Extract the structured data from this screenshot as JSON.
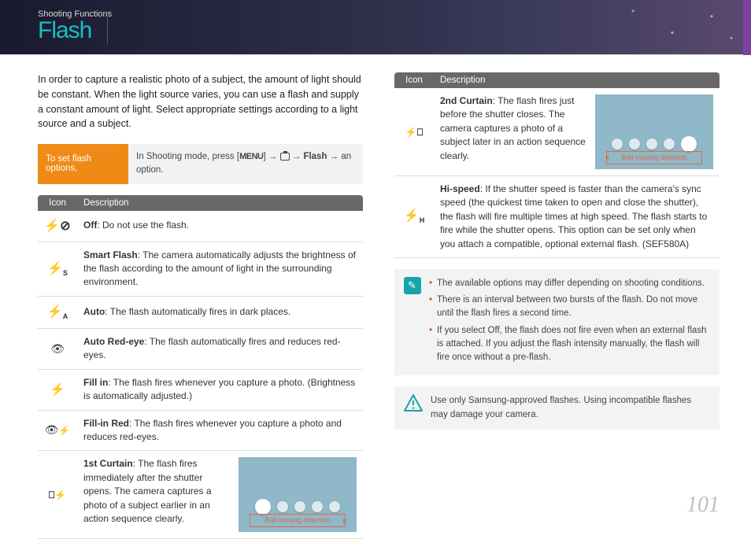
{
  "header": {
    "breadcrumb": "Shooting Functions",
    "title": "Flash"
  },
  "intro": "In order to capture a realistic photo of a subject, the amount of light should be constant. When the light source varies, you can use a flash and supply a constant amount of light. Select appropriate settings according to a light source and a subject.",
  "howto": {
    "label": "To set flash options,",
    "line_pre": "In Shooting mode, press [",
    "menu": "MENU",
    "mid1": "] → ",
    "mid2": " → ",
    "flash_label": "Flash",
    "tail": " → an option."
  },
  "table": {
    "head_icon": "Icon",
    "head_desc": "Description"
  },
  "rows_left": [
    {
      "title": "Off",
      "body": ": Do not use the flash."
    },
    {
      "title": "Smart Flash",
      "body": ": The camera automatically adjusts the brightness of the flash according to the amount of light in the surrounding environment."
    },
    {
      "title": "Auto",
      "body": ": The flash automatically fires in dark places."
    },
    {
      "title": "Auto Red-eye",
      "body": ": The flash automatically fires and reduces red-eyes."
    },
    {
      "title": "Fill in",
      "body": ": The flash fires whenever you capture a photo. (Brightness is automatically adjusted.)"
    },
    {
      "title": "Fill-in Red",
      "body": ": The flash fires whenever you capture a photo and reduces red-eyes."
    },
    {
      "title": "1st Curtain",
      "body": ": The flash fires immediately after the shutter opens. The camera captures a photo of a subject earlier in an action sequence clearly."
    }
  ],
  "rows_right": [
    {
      "title": "2nd Curtain",
      "body": ": The flash fires just before the shutter closes. The camera captures a photo of a subject later in an action sequence clearly."
    },
    {
      "title": "Hi-speed",
      "body": ": If the shutter speed is faster than the camera's sync speed (the quickest time taken to open and close the shutter), the flash will fire multiple times at high speed. The flash starts to fire while the shutter opens. This option can be set only when you attach a compatible, optional external flash. (SEF580A)"
    }
  ],
  "ball_dir_label": "Ball moving direction",
  "notes": [
    "The available options may differ depending on shooting conditions.",
    "There is an interval between two bursts of the flash. Do not move until the flash fires a second time.",
    "If you select Off, the flash does not fire even when an external flash is attached. If you adjust the flash intensity manually, the flash will fire once without a pre-flash."
  ],
  "warning": "Use only Samsung-approved flashes. Using incompatible flashes may damage your camera.",
  "page_number": "101"
}
